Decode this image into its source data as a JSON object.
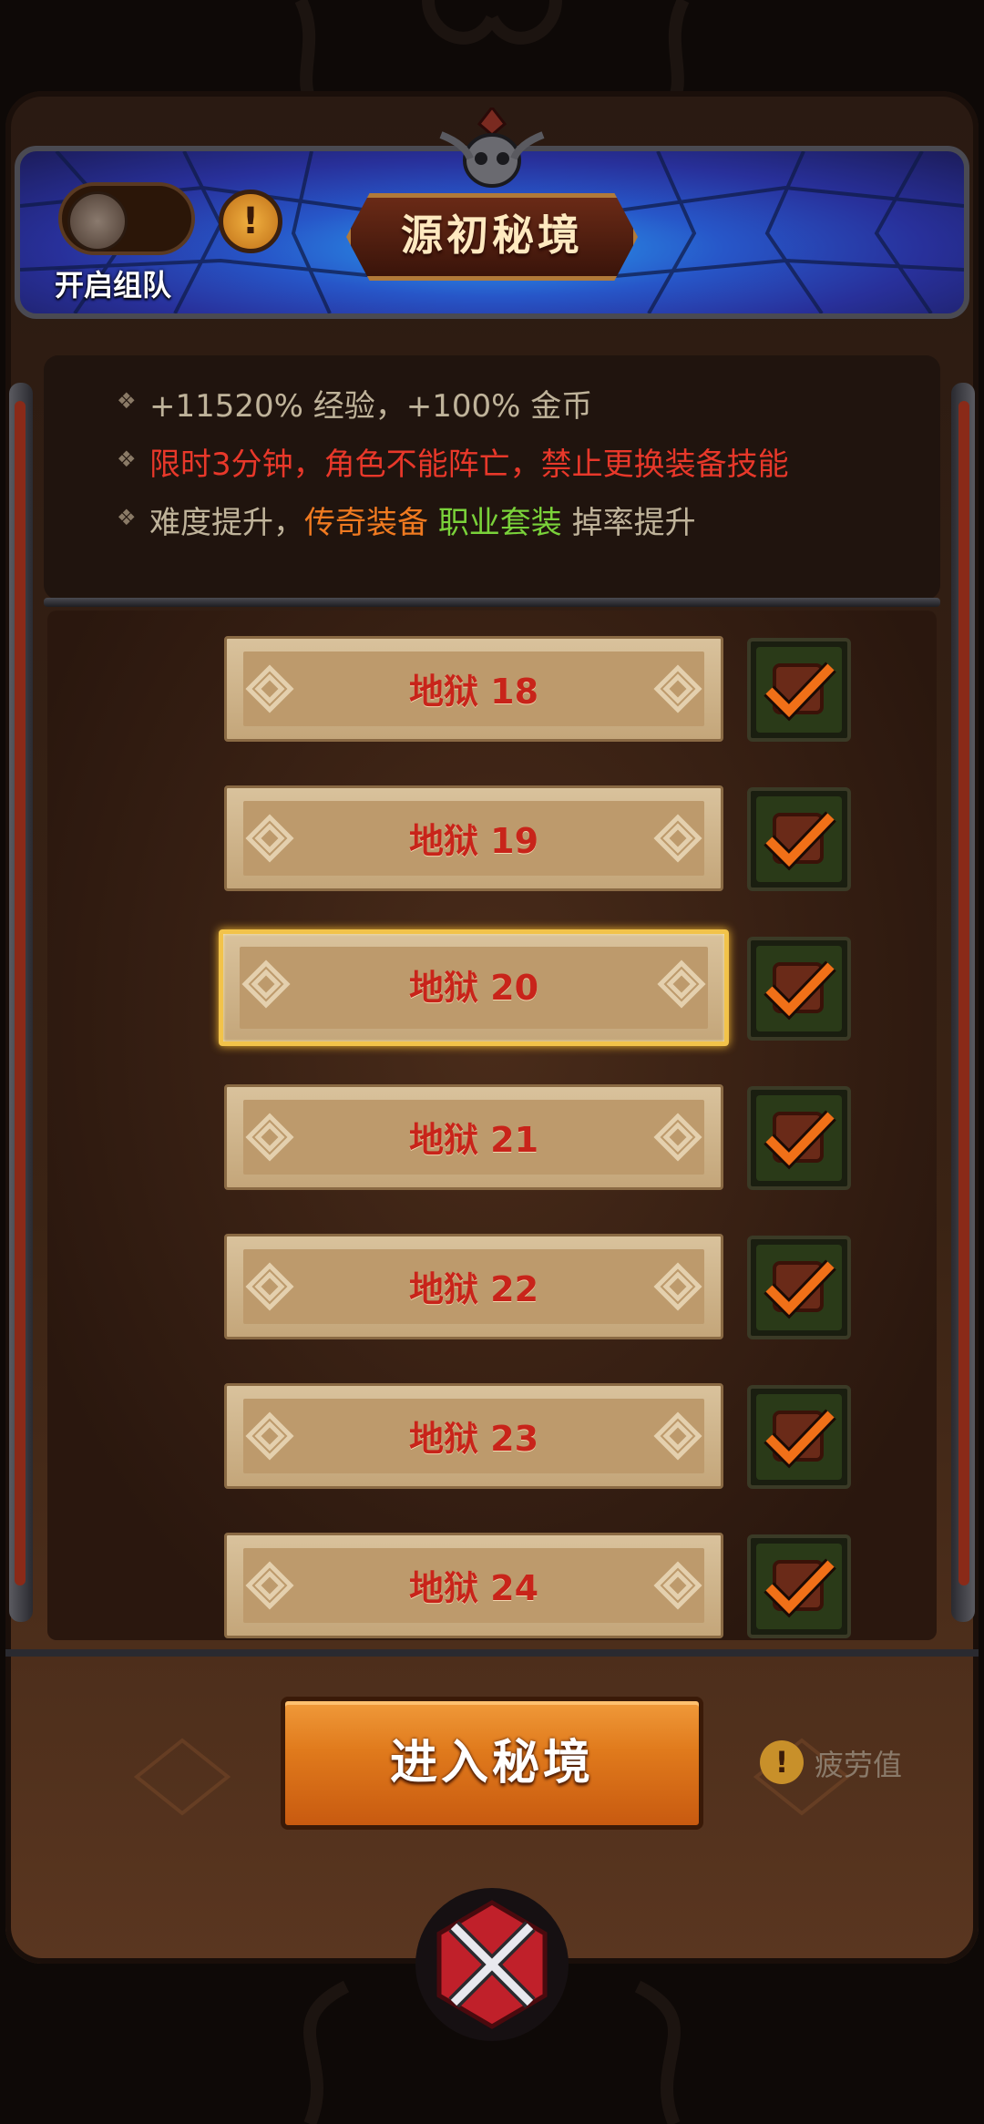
{
  "header": {
    "toggle_label": "开启组队",
    "title": "源初秘境"
  },
  "info": {
    "line1": "+11520% 经验，+100% 金币",
    "line2": "限时3分钟，角色不能阵亡，禁止更换装备技能",
    "line3_prefix": "难度提升，",
    "line3_legendary": "传奇装备",
    "line3_class_set": "职业套装",
    "line3_suffix": "掉率提升",
    "bullet": "❖"
  },
  "levels": [
    {
      "label": "地狱 18",
      "checked": true,
      "selected": false
    },
    {
      "label": "地狱 19",
      "checked": true,
      "selected": false
    },
    {
      "label": "地狱 20",
      "checked": true,
      "selected": true
    },
    {
      "label": "地狱 21",
      "checked": true,
      "selected": false
    },
    {
      "label": "地狱 22",
      "checked": true,
      "selected": false
    },
    {
      "label": "地狱 23",
      "checked": true,
      "selected": false
    },
    {
      "label": "地狱 24",
      "checked": true,
      "selected": false
    }
  ],
  "footer": {
    "enter_label": "进入秘境",
    "fatigue_label": "疲劳值",
    "fatigue_icon": "!"
  },
  "colors": {
    "line1": "#bfb39a",
    "line2": "#e8382a",
    "line3": "#bfb39a",
    "legendary": "#f07a20",
    "class_set": "#7ad23a",
    "level_text": "#c8241a",
    "selected_border": "#f2c34a",
    "check_orange": "#f07018"
  }
}
